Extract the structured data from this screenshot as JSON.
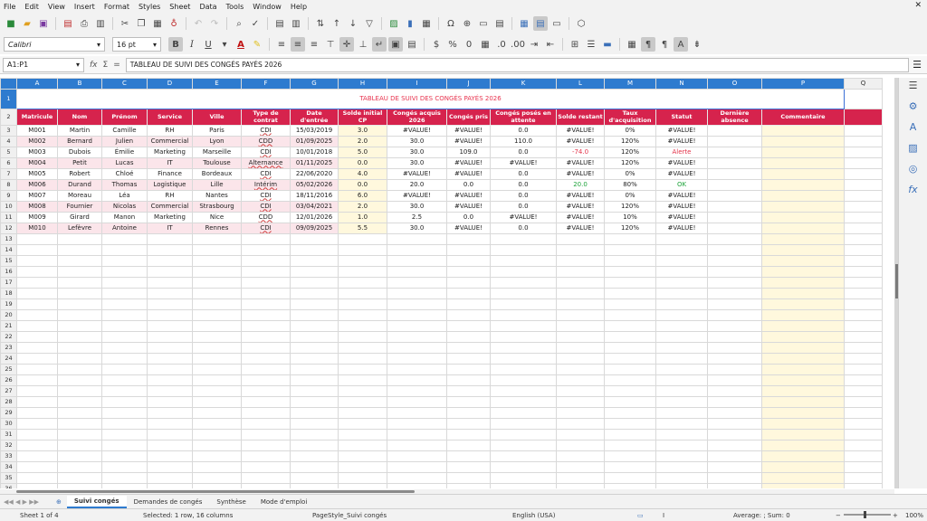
{
  "menu": [
    "File",
    "Edit",
    "View",
    "Insert",
    "Format",
    "Styles",
    "Sheet",
    "Data",
    "Tools",
    "Window",
    "Help"
  ],
  "close_glyph": "✕",
  "toolbar": {
    "font_name": "Calibri",
    "font_size": "16 pt"
  },
  "formula_bar": {
    "name_box": "A1:P1",
    "formula": "TABLEAU DE SUIVI DES CONGÉS PAYÉS 2026",
    "fx_glyph": "fx",
    "sum_glyph": "Σ",
    "equals_glyph": "="
  },
  "sheet": {
    "columns": [
      "A",
      "B",
      "C",
      "D",
      "E",
      "F",
      "G",
      "H",
      "I",
      "J",
      "K",
      "L",
      "M",
      "N",
      "O",
      "P",
      "Q"
    ],
    "title": "TABLEAU DE SUIVI DES CONGÉS PAYÉS 2026",
    "headers": [
      "Matricule",
      "Nom",
      "Prénom",
      "Service",
      "Ville",
      "Type de contrat",
      "Date d'entrée",
      "Solde initial CP",
      "Congés acquis 2026",
      "Congés pris",
      "Congés posés en attente",
      "Solde restant",
      "Taux d'acquisition",
      "Statut",
      "Dernière absence",
      "Commentaire"
    ],
    "rows": [
      [
        "M001",
        "Martin",
        "Camille",
        "RH",
        "Paris",
        "CDI",
        "15/03/2019",
        "3.0",
        "#VALUE!",
        "#VALUE!",
        "0.0",
        "#VALUE!",
        "0%",
        "#VALUE!",
        "",
        ""
      ],
      [
        "M002",
        "Bernard",
        "Julien",
        "Commercial",
        "Lyon",
        "CDD",
        "01/09/2025",
        "2.0",
        "30.0",
        "#VALUE!",
        "110.0",
        "#VALUE!",
        "120%",
        "#VALUE!",
        "",
        ""
      ],
      [
        "M003",
        "Dubois",
        "Émilie",
        "Marketing",
        "Marseille",
        "CDI",
        "10/01/2018",
        "5.0",
        "30.0",
        "109.0",
        "0.0",
        "-74.0",
        "120%",
        "Alerte",
        "",
        ""
      ],
      [
        "M004",
        "Petit",
        "Lucas",
        "IT",
        "Toulouse",
        "Alternance",
        "01/11/2025",
        "0.0",
        "30.0",
        "#VALUE!",
        "#VALUE!",
        "#VALUE!",
        "120%",
        "#VALUE!",
        "",
        ""
      ],
      [
        "M005",
        "Robert",
        "Chloé",
        "Finance",
        "Bordeaux",
        "CDI",
        "22/06/2020",
        "4.0",
        "#VALUE!",
        "#VALUE!",
        "0.0",
        "#VALUE!",
        "0%",
        "#VALUE!",
        "",
        ""
      ],
      [
        "M006",
        "Durand",
        "Thomas",
        "Logistique",
        "Lille",
        "Intérim",
        "05/02/2026",
        "0.0",
        "20.0",
        "0.0",
        "0.0",
        "20.0",
        "80%",
        "OK",
        "",
        ""
      ],
      [
        "M007",
        "Moreau",
        "Léa",
        "RH",
        "Nantes",
        "CDI",
        "18/11/2016",
        "6.0",
        "#VALUE!",
        "#VALUE!",
        "0.0",
        "#VALUE!",
        "0%",
        "#VALUE!",
        "",
        ""
      ],
      [
        "M008",
        "Fournier",
        "Nicolas",
        "Commercial",
        "Strasbourg",
        "CDI",
        "03/04/2021",
        "2.0",
        "30.0",
        "#VALUE!",
        "0.0",
        "#VALUE!",
        "120%",
        "#VALUE!",
        "",
        ""
      ],
      [
        "M009",
        "Girard",
        "Manon",
        "Marketing",
        "Nice",
        "CDD",
        "12/01/2026",
        "1.0",
        "2.5",
        "0.0",
        "#VALUE!",
        "#VALUE!",
        "10%",
        "#VALUE!",
        "",
        ""
      ],
      [
        "M010",
        "Lefèvre",
        "Antoine",
        "IT",
        "Rennes",
        "CDI",
        "09/09/2025",
        "5.5",
        "30.0",
        "#VALUE!",
        "0.0",
        "#VALUE!",
        "120%",
        "#VALUE!",
        "",
        ""
      ]
    ],
    "row_numbers": [
      "1",
      "2",
      "3",
      "4",
      "5",
      "6",
      "7",
      "8",
      "9",
      "10",
      "11",
      "12",
      "13",
      "14",
      "15",
      "16",
      "17",
      "18",
      "19",
      "20",
      "21",
      "22",
      "23",
      "24",
      "25",
      "26",
      "27",
      "28",
      "29",
      "30",
      "31",
      "32",
      "33",
      "34",
      "35",
      "36"
    ]
  },
  "tabs": {
    "nav_glyph": "◀◀ ◀ ▶ ▶▶",
    "add_glyph": "⊕",
    "items": [
      "Suivi congés",
      "Demandes de congés",
      "Synthèse",
      "Mode d'emploi"
    ],
    "active": "Suivi congés"
  },
  "status": {
    "sheet": "Sheet 1 of 4",
    "selection": "Selected: 1 row, 16 columns",
    "page_style": "PageStyle_Suivi congés",
    "language": "English (USA)",
    "stats": "Average: ; Sum: 0",
    "zoom": "100%"
  },
  "colors": {
    "header_bg": "#d6234d",
    "title_color": "#e8344f",
    "col_header_bg": "#2e7bcf",
    "alert_red": "#e3344a",
    "ok_green": "#1da33a"
  }
}
